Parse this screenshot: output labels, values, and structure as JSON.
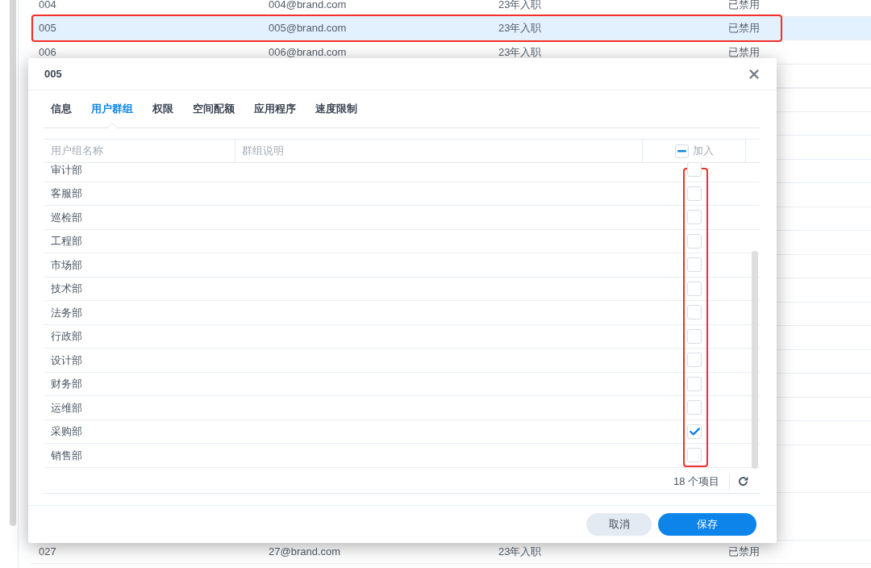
{
  "background_table": {
    "rows": [
      {
        "id": "004",
        "email": "004@brand.com",
        "note": "23年入职",
        "status": "已禁用",
        "selected": false,
        "outlined": false
      },
      {
        "id": "005",
        "email": "005@brand.com",
        "note": "23年入职",
        "status": "已禁用",
        "selected": true,
        "outlined": true
      },
      {
        "id": "006",
        "email": "006@brand.com",
        "note": "23年入职",
        "status": "已禁用",
        "selected": false,
        "outlined": false
      },
      {
        "id": "027",
        "email": "27@brand.com",
        "note": "23年入职",
        "status": "已禁用",
        "selected": false,
        "outlined": false
      }
    ]
  },
  "dialog": {
    "title": "005",
    "tabs": [
      {
        "label": "信息",
        "selected": false
      },
      {
        "label": "用户群组",
        "selected": true
      },
      {
        "label": "权限",
        "selected": false
      },
      {
        "label": "空间配额",
        "selected": false
      },
      {
        "label": "应用程序",
        "selected": false
      },
      {
        "label": "速度限制",
        "selected": false
      }
    ],
    "group_table": {
      "columns": [
        {
          "label": "用户组名称"
        },
        {
          "label": "群组说明"
        },
        {
          "label": "加入"
        }
      ],
      "join_all_indeterminate": true,
      "join_column_outlined": true,
      "rows": [
        {
          "name": "审计部",
          "joined": false
        },
        {
          "name": "客服部",
          "joined": false
        },
        {
          "name": "巡检部",
          "joined": false
        },
        {
          "name": "工程部",
          "joined": false
        },
        {
          "name": "市场部",
          "joined": false
        },
        {
          "name": "技术部",
          "joined": false
        },
        {
          "name": "法务部",
          "joined": false
        },
        {
          "name": "行政部",
          "joined": false
        },
        {
          "name": "设计部",
          "joined": false
        },
        {
          "name": "财务部",
          "joined": false
        },
        {
          "name": "运维部",
          "joined": false
        },
        {
          "name": "采购部",
          "joined": true
        },
        {
          "name": "销售部",
          "joined": false
        }
      ],
      "item_count": "18 个项目"
    },
    "buttons": [
      {
        "label": "取消",
        "kind": "secondary"
      },
      {
        "label": "保存",
        "kind": "primary"
      }
    ]
  }
}
